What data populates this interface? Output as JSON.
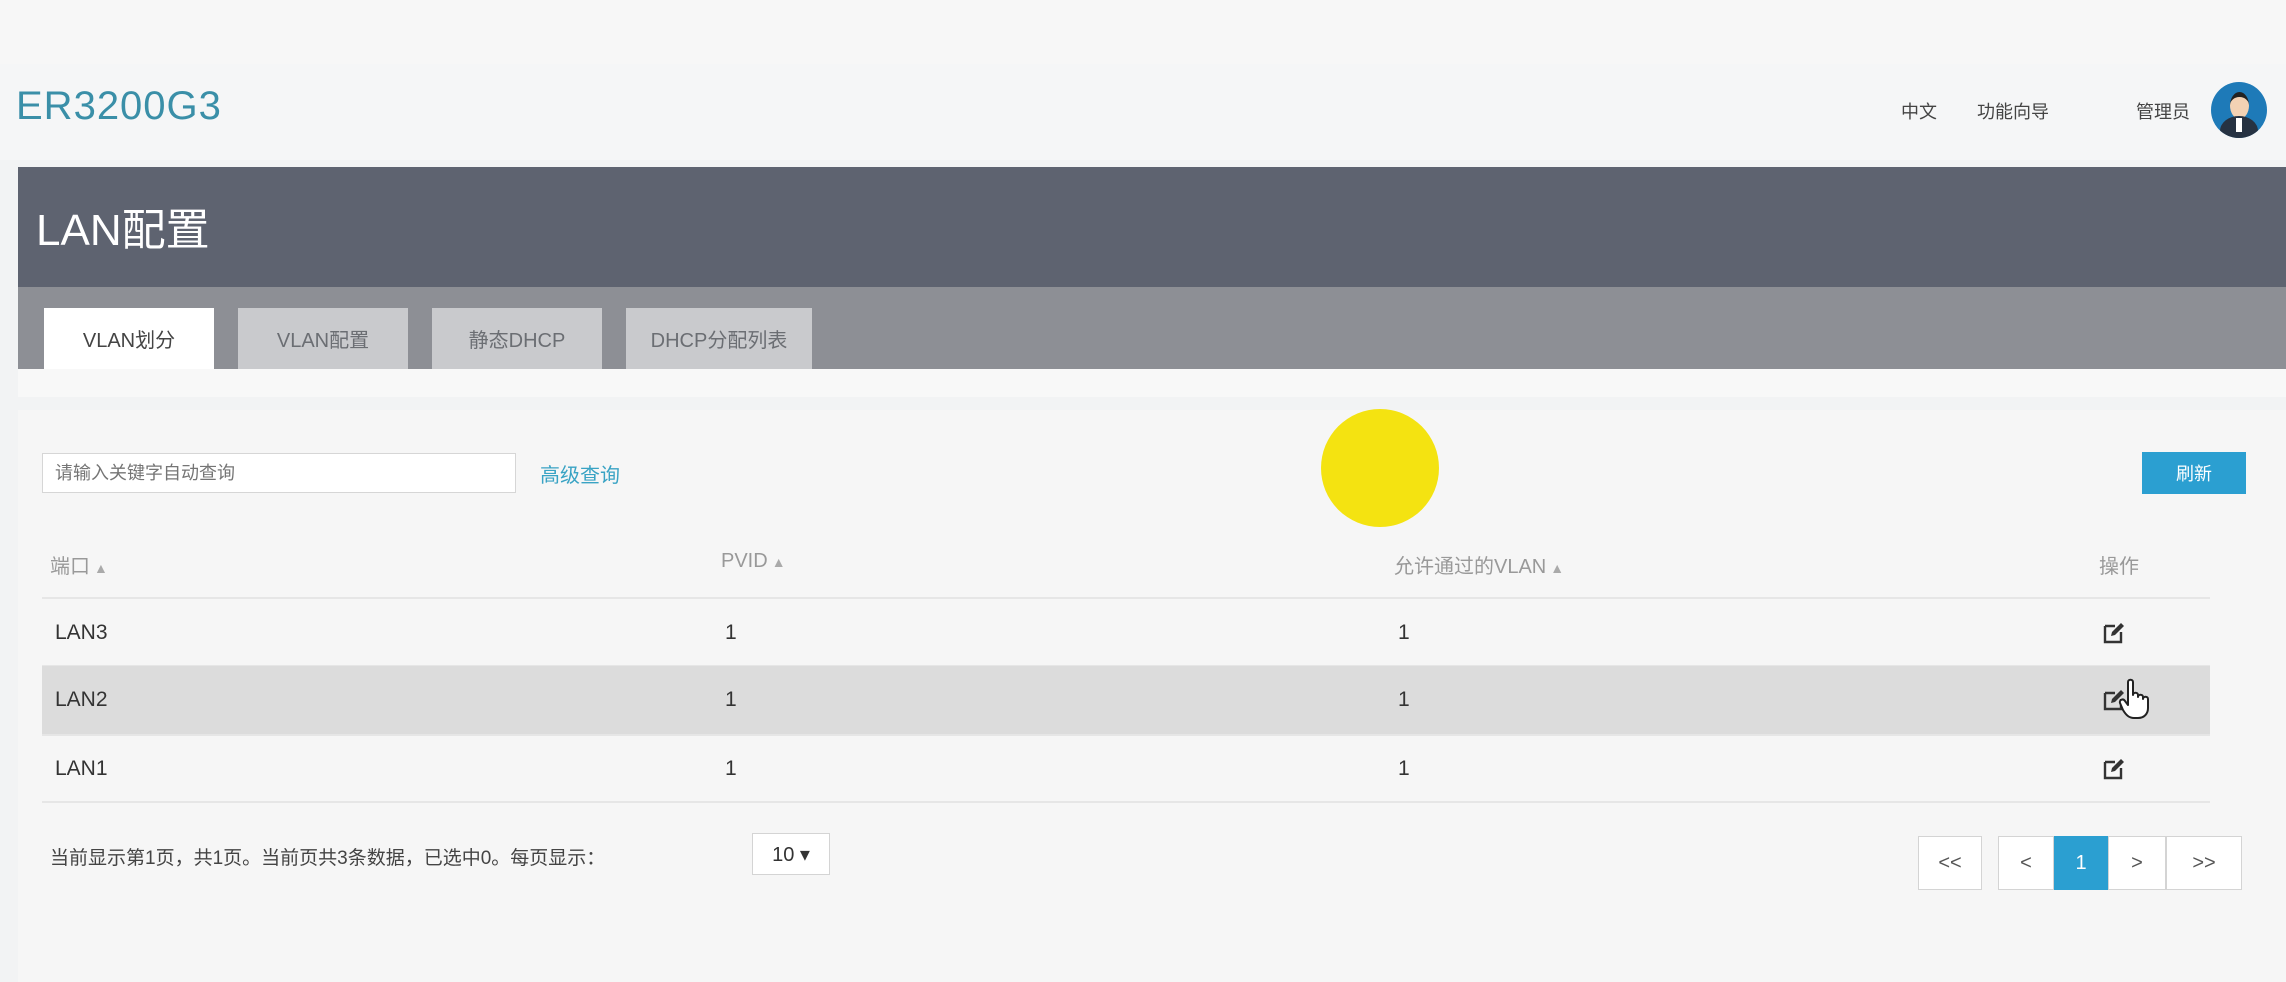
{
  "header": {
    "brand": "ER3200G3",
    "lang": "中文",
    "wizard": "功能向导",
    "user": "管理员"
  },
  "banner": {
    "title": "LAN配置"
  },
  "tabs": [
    {
      "label": "VLAN划分",
      "active": true
    },
    {
      "label": "VLAN配置",
      "active": false
    },
    {
      "label": "静态DHCP",
      "active": false
    },
    {
      "label": "DHCP分配列表",
      "active": false
    }
  ],
  "toolbar": {
    "search_placeholder": "请输入关键字自动查询",
    "advanced": "高级查询",
    "refresh": "刷新"
  },
  "table": {
    "columns": [
      "端口",
      "PVID",
      "允许通过的VLAN",
      "操作"
    ],
    "sort_arrow": "▲",
    "rows": [
      {
        "port": "LAN3",
        "pvid": "1",
        "vlan": "1"
      },
      {
        "port": "LAN2",
        "pvid": "1",
        "vlan": "1",
        "highlighted": true
      },
      {
        "port": "LAN1",
        "pvid": "1",
        "vlan": "1"
      }
    ]
  },
  "footer": {
    "info": "当前显示第1页，共1页。当前页共3条数据，已选中0。每页显示：",
    "page_size": "10 ▾"
  },
  "pagination": {
    "first": "<<",
    "prev": "<",
    "current": "1",
    "next": ">",
    "last": ">>"
  },
  "icons": [
    "avatar-icon",
    "edit-icon",
    "hand-cursor-icon",
    "sort-arrow-icon"
  ],
  "colors": {
    "accent": "#2b9fd1",
    "brand": "#3a8fa8",
    "banner": "#5e6370",
    "marker": "#f4e311"
  }
}
